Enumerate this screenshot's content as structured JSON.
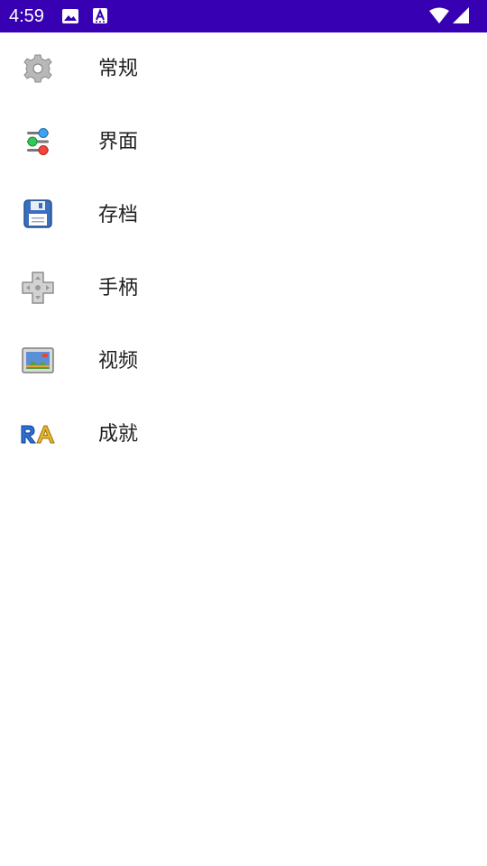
{
  "status_bar": {
    "time": "4:59",
    "background": "#3700b3",
    "icons": [
      "image-icon",
      "font-a-icon",
      "wifi-icon",
      "signal-icon"
    ]
  },
  "menu": {
    "items": [
      {
        "label": "常规",
        "icon": "gear-icon"
      },
      {
        "label": "界面",
        "icon": "sliders-icon"
      },
      {
        "label": "存档",
        "icon": "floppy-disk-icon"
      },
      {
        "label": "手柄",
        "icon": "gamepad-dpad-icon"
      },
      {
        "label": "视频",
        "icon": "monitor-picture-icon"
      },
      {
        "label": "成就",
        "icon": "retroachievements-icon"
      }
    ]
  }
}
